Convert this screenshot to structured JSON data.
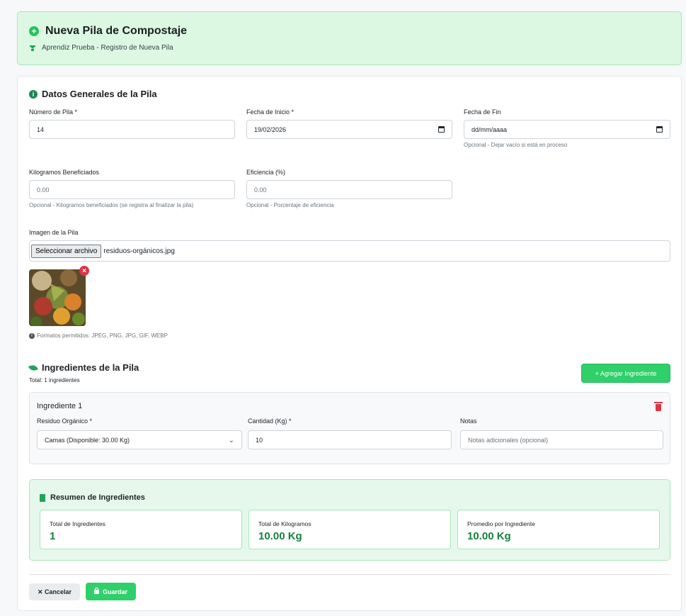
{
  "header": {
    "title": "Nueva Pila de Compostaje",
    "subtitle": "Aprendiz Prueba - Registro de Nueva Pila"
  },
  "general": {
    "section_title": "Datos Generales de la Pila",
    "numero_label": "Número de Pila *",
    "numero_value": "14",
    "fecha_inicio_label": "Fecha de Inicio *",
    "fecha_inicio_value": "19/02/2026",
    "fecha_fin_label": "Fecha de Fin",
    "fecha_fin_placeholder": "dd/mm/aaaa",
    "fecha_fin_help": "Opcional - Dejar vacío si está en proceso",
    "kilos_label": "Kilogramos Beneficiados",
    "kilos_placeholder": "0.00",
    "kilos_help": "Opcional - Kilogramos beneficiados (se registra al finalizar la pila)",
    "eficiencia_label": "Eficiencia (%)",
    "eficiencia_placeholder": "0.00",
    "eficiencia_help": "Opcional - Porcentaje de eficiencia",
    "imagen_label": "Imagen de la Pila",
    "file_button": "Seleccionar archivo",
    "file_name": "residuos-orgánicos.jpg",
    "formats_help": "Formatos permitidos: JPEG, PNG, JPG, GIF, WEBP"
  },
  "ingredients": {
    "section_title": "Ingredientes de la Pila",
    "total_text": "Total: 1 ingredientes",
    "add_button": "+ Agregar Ingrediente",
    "items": [
      {
        "title": "Ingrediente 1",
        "residuo_label": "Residuo Orgánico *",
        "residuo_value": "Camas (Disponible: 30.00 Kg)",
        "cantidad_label": "Cantidad (Kg) *",
        "cantidad_value": "10",
        "notas_label": "Notas",
        "notas_placeholder": "Notas adicionales (opcional)"
      }
    ]
  },
  "summary": {
    "title": "Resumen de Ingredientes",
    "boxes": [
      {
        "label": "Total de Ingredientes",
        "value": "1"
      },
      {
        "label": "Total de Kilogramos",
        "value": "10.00 Kg"
      },
      {
        "label": "Promedio por Ingrediente",
        "value": "10.00 Kg"
      }
    ]
  },
  "actions": {
    "cancel": "✕ Cancelar",
    "save": "Guardar"
  },
  "colors": {
    "accent": "#2fd06a",
    "header_bg": "#dcf8e3",
    "summary_value": "#15803d",
    "danger": "#dc3545"
  }
}
